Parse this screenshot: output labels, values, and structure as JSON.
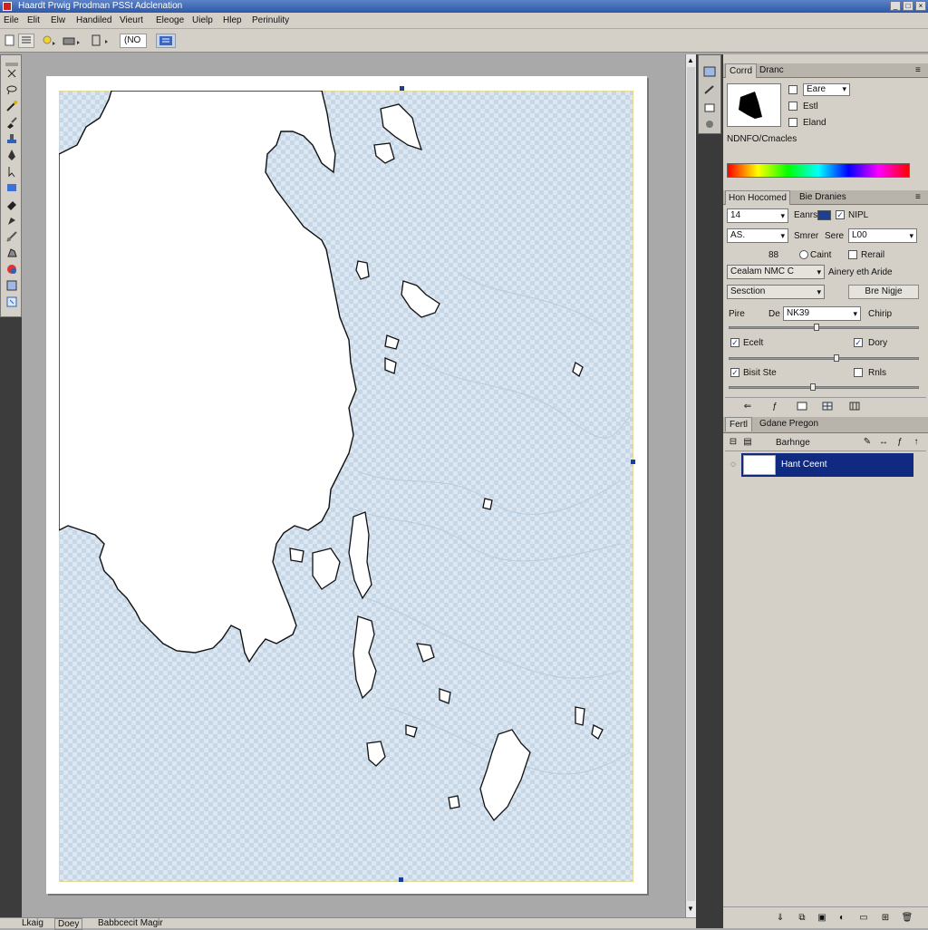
{
  "window": {
    "title": "Haardt Prwig Prodman PSSt Adclenation",
    "min": "_",
    "max": "□",
    "close": "×"
  },
  "menu": [
    "Eile",
    "Elit",
    "Elw",
    "Handiled",
    "Vieurt",
    "Eleoge",
    "Uielp",
    "Hlep",
    "Perinulity"
  ],
  "options": {
    "zoom_value": "(NO"
  },
  "status": {
    "left": "Lkaig",
    "tab": "Doey",
    "doc": "Babbcecit Magir"
  },
  "navigator": {
    "tab_active": "Corrd",
    "tab_other": "Dranc",
    "dropdown": "Eare",
    "check1": "Estl",
    "check2": "Eland",
    "caption": "NDNFO/Cmacles"
  },
  "character": {
    "tab_active": "Hon Hocomed",
    "tab_other": "Bie Dranies",
    "size_value": "14",
    "size_label": "Eanrs",
    "mode_label": "NIPL",
    "font_value": "AS.",
    "smrer_label": "Smrer",
    "sere_label": "Sere",
    "sere_value": "L00",
    "num_value": "88",
    "radio_label": "Caint",
    "right_check_label": "Rerail",
    "dropdown1": "Cealam NMC C",
    "label_right1": "Ainery eth Aride",
    "dropdown2": "Sesction",
    "btn_right": "Bre Nigje",
    "pire_label": "Pire",
    "de_label": "De",
    "de_value": "NK39",
    "chirip_label": "Chirip",
    "check_ecelt": "Ecelt",
    "check_dory": "Dory",
    "check_bisit": "Bisit Ste",
    "check_rnls": "Rnls",
    "ecelt_checked": true,
    "dory_checked": true,
    "bisit_checked": true,
    "rnls_checked": false
  },
  "layers": {
    "tab_active": "Fertl",
    "tab_other": "Gdane Pregon",
    "toolbar_label": "Barhnge",
    "layer_name": "Hant Ceent"
  },
  "colors": {
    "selection": "#0f2a80",
    "chrome": "#d4d0c8",
    "paper_ink": "#111111"
  }
}
